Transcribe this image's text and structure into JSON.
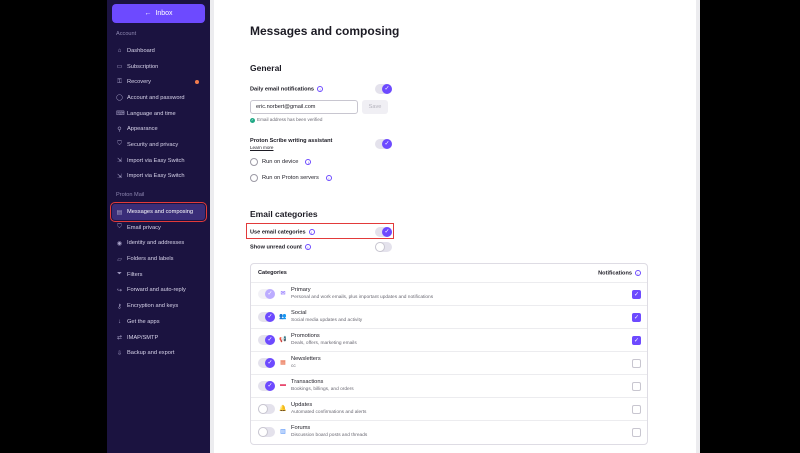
{
  "sidebar": {
    "inbox_button": "Inbox",
    "account_section": "Account",
    "account_items": [
      {
        "label": "Dashboard",
        "icon": "⌂"
      },
      {
        "label": "Subscription",
        "icon": "▭"
      },
      {
        "label": "Recovery",
        "icon": "⚿"
      },
      {
        "label": "Account and password",
        "icon": "◯"
      },
      {
        "label": "Language and time",
        "icon": "⌨"
      },
      {
        "label": "Appearance",
        "icon": "⚲"
      },
      {
        "label": "Security and privacy",
        "icon": "⛉"
      },
      {
        "label": "Import via Easy Switch",
        "icon": "⇲"
      },
      {
        "label": "Import via Easy Switch",
        "icon": "⇲"
      }
    ],
    "mail_section": "Proton Mail",
    "mail_items": [
      {
        "label": "Messages and composing",
        "icon": "▤"
      },
      {
        "label": "Email privacy",
        "icon": "⛉"
      },
      {
        "label": "Identity and addresses",
        "icon": "◉"
      },
      {
        "label": "Folders and labels",
        "icon": "▱"
      },
      {
        "label": "Filters",
        "icon": "⏷"
      },
      {
        "label": "Forward and auto-reply",
        "icon": "↪"
      },
      {
        "label": "Encryption and keys",
        "icon": "⚷"
      },
      {
        "label": "Get the apps",
        "icon": "↓"
      },
      {
        "label": "IMAP/SMTP",
        "icon": "⇄"
      },
      {
        "label": "Backup and export",
        "icon": "⇩"
      }
    ],
    "accent_color": "#6d4aff"
  },
  "main": {
    "page_title": "Messages and composing",
    "general_heading": "General",
    "daily_label": "Daily email notifications",
    "email_value": "eric.norbert@gmail.com",
    "save_label": "Save",
    "verified_text": "Email address has been verified",
    "scribe_label": "Proton Scribe writing assistant",
    "learn_more": "Learn more",
    "run_device": "Run on device",
    "run_servers": "Run on Proton servers",
    "categories_heading": "Email categories",
    "use_categories": "Use email categories",
    "show_unread": "Show unread count",
    "table": {
      "col_categories": "Categories",
      "col_notifications": "Notifications",
      "rows": [
        {
          "name": "Primary",
          "desc": "Personal and work emails, plus important updates and notifications",
          "icon": "✉",
          "icon_color": "#6d4aff",
          "enabled": true,
          "locked": true,
          "notify": true
        },
        {
          "name": "Social",
          "desc": "Social media updates and activity",
          "icon": "👥",
          "icon_color": "#3b82f6",
          "enabled": true,
          "locked": false,
          "notify": true
        },
        {
          "name": "Promotions",
          "desc": "Deals, offers, marketing emails",
          "icon": "📢",
          "icon_color": "#1ea885",
          "enabled": true,
          "locked": false,
          "notify": true
        },
        {
          "name": "Newsletters",
          "desc": "cc",
          "icon": "▦",
          "icon_color": "#e8613c",
          "enabled": true,
          "locked": false,
          "notify": false
        },
        {
          "name": "Transactions",
          "desc": "Bookings, billings, and orders",
          "icon": "▬",
          "icon_color": "#e84a6f",
          "enabled": true,
          "locked": false,
          "notify": false
        },
        {
          "name": "Updates",
          "desc": "Automated confirmations and alerts",
          "icon": "🔔",
          "icon_color": "#d946ef",
          "enabled": false,
          "locked": false,
          "notify": false
        },
        {
          "name": "Forums",
          "desc": "Discussion board posts and threads",
          "icon": "▥",
          "icon_color": "#3b82f6",
          "enabled": false,
          "locked": false,
          "notify": false
        }
      ]
    }
  }
}
